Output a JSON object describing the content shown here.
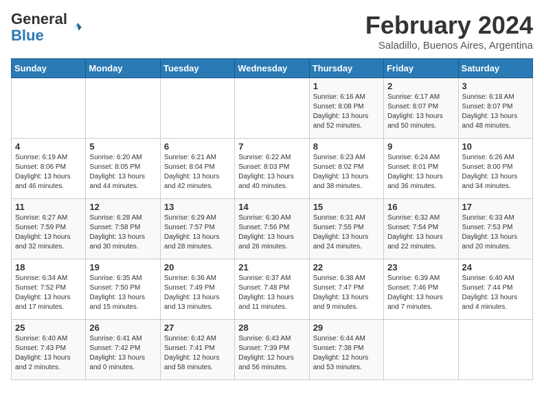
{
  "header": {
    "logo_general": "General",
    "logo_blue": "Blue",
    "month_year": "February 2024",
    "location": "Saladillo, Buenos Aires, Argentina"
  },
  "weekdays": [
    "Sunday",
    "Monday",
    "Tuesday",
    "Wednesday",
    "Thursday",
    "Friday",
    "Saturday"
  ],
  "weeks": [
    [
      {
        "day": "",
        "info": ""
      },
      {
        "day": "",
        "info": ""
      },
      {
        "day": "",
        "info": ""
      },
      {
        "day": "",
        "info": ""
      },
      {
        "day": "1",
        "info": "Sunrise: 6:16 AM\nSunset: 8:08 PM\nDaylight: 13 hours\nand 52 minutes."
      },
      {
        "day": "2",
        "info": "Sunrise: 6:17 AM\nSunset: 8:07 PM\nDaylight: 13 hours\nand 50 minutes."
      },
      {
        "day": "3",
        "info": "Sunrise: 6:18 AM\nSunset: 8:07 PM\nDaylight: 13 hours\nand 48 minutes."
      }
    ],
    [
      {
        "day": "4",
        "info": "Sunrise: 6:19 AM\nSunset: 8:06 PM\nDaylight: 13 hours\nand 46 minutes."
      },
      {
        "day": "5",
        "info": "Sunrise: 6:20 AM\nSunset: 8:05 PM\nDaylight: 13 hours\nand 44 minutes."
      },
      {
        "day": "6",
        "info": "Sunrise: 6:21 AM\nSunset: 8:04 PM\nDaylight: 13 hours\nand 42 minutes."
      },
      {
        "day": "7",
        "info": "Sunrise: 6:22 AM\nSunset: 8:03 PM\nDaylight: 13 hours\nand 40 minutes."
      },
      {
        "day": "8",
        "info": "Sunrise: 6:23 AM\nSunset: 8:02 PM\nDaylight: 13 hours\nand 38 minutes."
      },
      {
        "day": "9",
        "info": "Sunrise: 6:24 AM\nSunset: 8:01 PM\nDaylight: 13 hours\nand 36 minutes."
      },
      {
        "day": "10",
        "info": "Sunrise: 6:26 AM\nSunset: 8:00 PM\nDaylight: 13 hours\nand 34 minutes."
      }
    ],
    [
      {
        "day": "11",
        "info": "Sunrise: 6:27 AM\nSunset: 7:59 PM\nDaylight: 13 hours\nand 32 minutes."
      },
      {
        "day": "12",
        "info": "Sunrise: 6:28 AM\nSunset: 7:58 PM\nDaylight: 13 hours\nand 30 minutes."
      },
      {
        "day": "13",
        "info": "Sunrise: 6:29 AM\nSunset: 7:57 PM\nDaylight: 13 hours\nand 28 minutes."
      },
      {
        "day": "14",
        "info": "Sunrise: 6:30 AM\nSunset: 7:56 PM\nDaylight: 13 hours\nand 26 minutes."
      },
      {
        "day": "15",
        "info": "Sunrise: 6:31 AM\nSunset: 7:55 PM\nDaylight: 13 hours\nand 24 minutes."
      },
      {
        "day": "16",
        "info": "Sunrise: 6:32 AM\nSunset: 7:54 PM\nDaylight: 13 hours\nand 22 minutes."
      },
      {
        "day": "17",
        "info": "Sunrise: 6:33 AM\nSunset: 7:53 PM\nDaylight: 13 hours\nand 20 minutes."
      }
    ],
    [
      {
        "day": "18",
        "info": "Sunrise: 6:34 AM\nSunset: 7:52 PM\nDaylight: 13 hours\nand 17 minutes."
      },
      {
        "day": "19",
        "info": "Sunrise: 6:35 AM\nSunset: 7:50 PM\nDaylight: 13 hours\nand 15 minutes."
      },
      {
        "day": "20",
        "info": "Sunrise: 6:36 AM\nSunset: 7:49 PM\nDaylight: 13 hours\nand 13 minutes."
      },
      {
        "day": "21",
        "info": "Sunrise: 6:37 AM\nSunset: 7:48 PM\nDaylight: 13 hours\nand 11 minutes."
      },
      {
        "day": "22",
        "info": "Sunrise: 6:38 AM\nSunset: 7:47 PM\nDaylight: 13 hours\nand 9 minutes."
      },
      {
        "day": "23",
        "info": "Sunrise: 6:39 AM\nSunset: 7:46 PM\nDaylight: 13 hours\nand 7 minutes."
      },
      {
        "day": "24",
        "info": "Sunrise: 6:40 AM\nSunset: 7:44 PM\nDaylight: 13 hours\nand 4 minutes."
      }
    ],
    [
      {
        "day": "25",
        "info": "Sunrise: 6:40 AM\nSunset: 7:43 PM\nDaylight: 13 hours\nand 2 minutes."
      },
      {
        "day": "26",
        "info": "Sunrise: 6:41 AM\nSunset: 7:42 PM\nDaylight: 13 hours\nand 0 minutes."
      },
      {
        "day": "27",
        "info": "Sunrise: 6:42 AM\nSunset: 7:41 PM\nDaylight: 12 hours\nand 58 minutes."
      },
      {
        "day": "28",
        "info": "Sunrise: 6:43 AM\nSunset: 7:39 PM\nDaylight: 12 hours\nand 56 minutes."
      },
      {
        "day": "29",
        "info": "Sunrise: 6:44 AM\nSunset: 7:38 PM\nDaylight: 12 hours\nand 53 minutes."
      },
      {
        "day": "",
        "info": ""
      },
      {
        "day": "",
        "info": ""
      }
    ]
  ]
}
